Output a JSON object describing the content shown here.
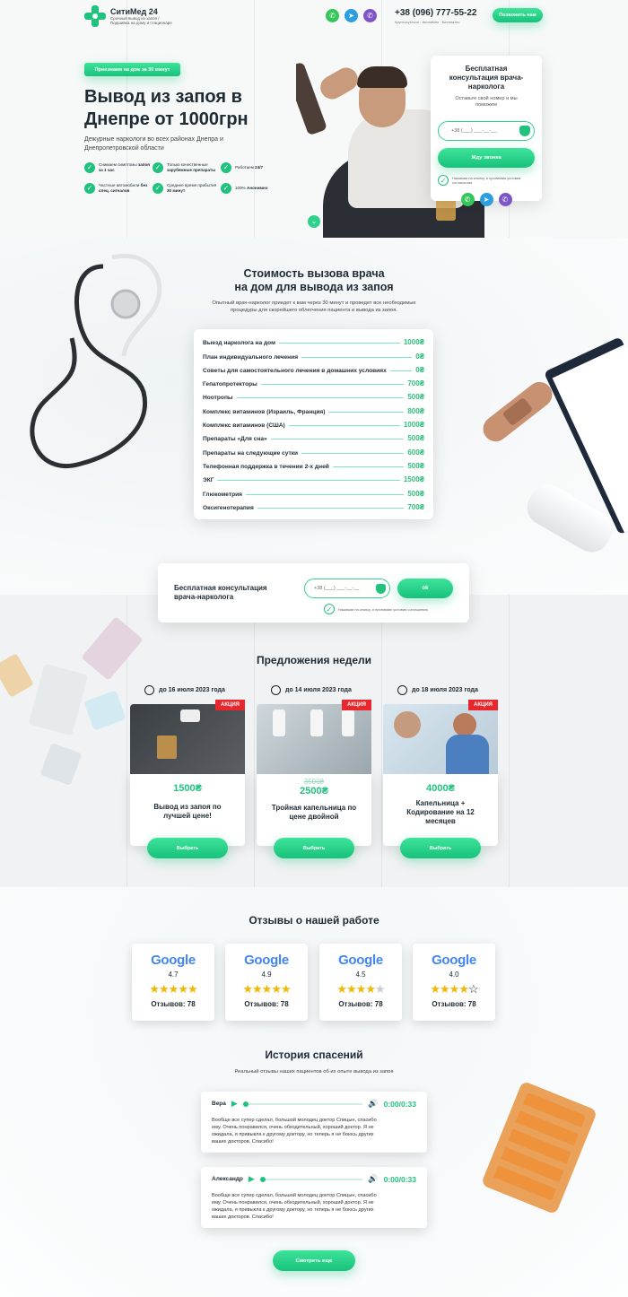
{
  "header": {
    "logo_name": "СитиМед 24",
    "logo_sub1": "Срочный вывод из запоя /",
    "logo_sub2": "Подшивка на дому и стационаре",
    "phone": "+38 (096) 777-55-22",
    "phone_sub": "Круглосуточно · Анонимно · Бесплатно",
    "call_button": "Позвонить нам"
  },
  "hero": {
    "badge": "Приезжаем на дом за 30 минут",
    "title_line1": "Вывод из запоя в",
    "title_line2": "Днепре от 1000грн",
    "subtitle_line1": "Дежурные наркологи во всех районах Днепра и",
    "subtitle_line2": "Днепропетровской области",
    "features": [
      {
        "text": "Снимаем симптомы",
        "bold": "запоя за 1 час"
      },
      {
        "text": "Только качественные",
        "bold": "зарубежные препараты"
      },
      {
        "text": "Работаем",
        "bold": "24/7"
      },
      {
        "text": "Частные автомобили",
        "bold": "без спец. сигналов"
      },
      {
        "text": "Среднее время прибытия",
        "bold": "30 минут"
      },
      {
        "text": "100%",
        "bold": "Анонимно"
      }
    ]
  },
  "consult_form": {
    "title": "Бесплатная консультация врача-нарколога",
    "subtitle": "Оставьте свой номер и мы поможем",
    "phone_placeholder": "+38 (___) ___-__-__",
    "submit": "Жду звонка",
    "consent": "Нажимая на кнопку, я принимаю условия соглашения"
  },
  "pricing": {
    "title_line1": "Стоимость вызова врача",
    "title_line2": "на дом для вывода из запоя",
    "desc_line1": "Опытный врач-нарколог приедет к вам через 30 минут и проведет все необходимые",
    "desc_line2": "процедуры для скорейшего облегчения пациента и вывода из запоя.",
    "rows": [
      {
        "name": "Выезд нарколога на дом",
        "price": "1000₴"
      },
      {
        "name": "План индивидуального лечения",
        "price": "0₴"
      },
      {
        "name": "Советы для самостоятельного лечения в домашних условиях",
        "price": "0₴"
      },
      {
        "name": "Гепатопротекторы",
        "price": "700₴"
      },
      {
        "name": "Ноотропы",
        "price": "500₴"
      },
      {
        "name": "Комплекс витаминов (Израиль, Франция)",
        "price": "800₴"
      },
      {
        "name": "Комплекс витаминов (США)",
        "price": "1000₴"
      },
      {
        "name": "Препараты «Для сна»",
        "price": "500₴"
      },
      {
        "name": "Препараты на следующие сутки",
        "price": "600₴"
      },
      {
        "name": "Телефонная поддержка в течении 2-х дней",
        "price": "500₴"
      },
      {
        "name": "ЭКГ",
        "price": "1500₴"
      },
      {
        "name": "Глюкометрия",
        "price": "500₴"
      },
      {
        "name": "Оксигенотерапия",
        "price": "700₴"
      }
    ]
  },
  "mid_form": {
    "title_line1": "Бесплатная консультация",
    "title_line2": "врача-нарколога",
    "phone_placeholder": "+38 (___) ___-__-__",
    "submit": "ok",
    "consent": "Нажимая на кнопку, я принимаю условия соглашения"
  },
  "offers": {
    "title": "Предложения недели",
    "items": [
      {
        "date": "до 16 июля 2023 года",
        "tag": "АКЦИЯ",
        "old_price": "",
        "price": "1500₴",
        "name_line1": "Вывод из запоя по",
        "name_line2": "лучшей цене!",
        "name_line3": "",
        "button": "Выбрать"
      },
      {
        "date": "до 14 июля 2023 года",
        "tag": "АКЦИЯ",
        "old_price": "3500₴",
        "price": "2500₴",
        "name_line1": "Тройная капельница по",
        "name_line2": "цене двойной",
        "name_line3": "",
        "button": "Выбрать"
      },
      {
        "date": "до 18 июля 2023 года",
        "tag": "АКЦИЯ",
        "old_price": "",
        "price": "4000₴",
        "name_line1": "Капельница +",
        "name_line2": "Кодирование на 12",
        "name_line3": "месяцев",
        "button": "Выбрать"
      }
    ]
  },
  "reviews": {
    "title": "Отзывы о нашей работе",
    "logo_text": "Google",
    "items": [
      {
        "rating": "4.7",
        "stars": 4.7,
        "count": "Отзывов: 78"
      },
      {
        "rating": "4.9",
        "stars": 4.9,
        "count": "Отзывов: 78"
      },
      {
        "rating": "4.5",
        "stars": 4.5,
        "count": "Отзывов: 78"
      },
      {
        "rating": "4.0",
        "stars": 4.0,
        "count": "Отзывов: 78"
      }
    ]
  },
  "stories": {
    "title": "История спасений",
    "subtitle": "Реальный отзывы наших пациентов об их опыте вывода из запоя",
    "items": [
      {
        "name": "Вера",
        "time": "0:00/0:33",
        "text_line1": "Вообще все супер сделал, большой молодец доктор Спицын, спасибо",
        "text_line2": "ему. Очень понравился, очень обходительный, хороший доктор. Я не",
        "text_line3": "ожидала, я привыкла к другому доктору, но теперь я не боюсь других",
        "text_line4": "ваших докторов. Спасибо!"
      },
      {
        "name": "Александр",
        "time": "0:00/0:33",
        "text_line1": "Вообще все супер сделал, большой молодец доктор Спицын, спасибо",
        "text_line2": "ему. Очень понравился, очень обходительный, хороший доктор. Я не",
        "text_line3": "ожидала, я привыкла к другому доктору, но теперь я не боюсь других",
        "text_line4": "ваших докторов. Спасибо!"
      }
    ],
    "more_button": "Смотреть еще"
  },
  "colors": {
    "accent": "#21c27d",
    "accent_light": "#3fe39a",
    "tag_red": "#e8262c",
    "text": "#1f2a33"
  },
  "icons": [
    "whatsapp-icon",
    "telegram-icon",
    "viber-icon",
    "shield-icon",
    "check-icon",
    "clock-icon",
    "play-icon",
    "volume-icon",
    "chevron-down-icon"
  ]
}
